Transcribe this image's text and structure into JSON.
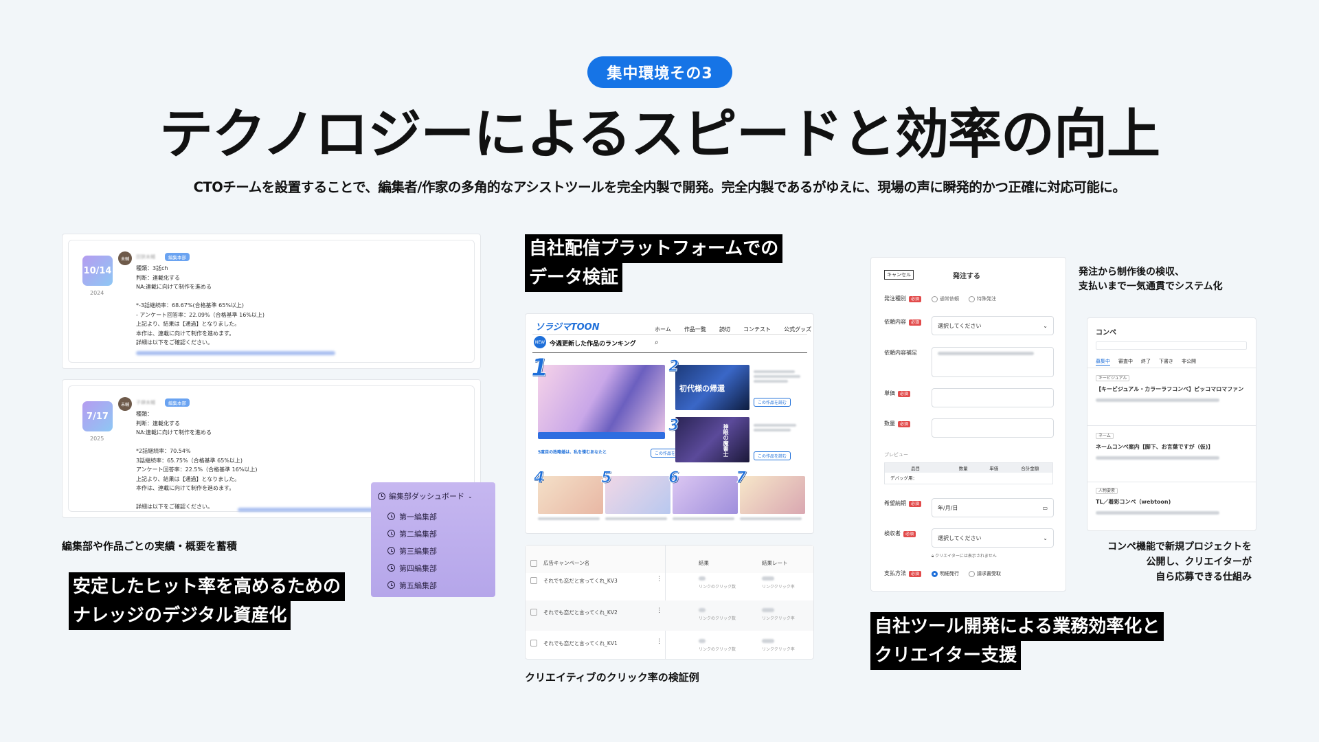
{
  "header": {
    "badge": "集中環境その3",
    "title": "テクノロジーによるスピードと効率の向上",
    "subtitle": "CTOチームを設置することで、編集者/作家の多角的なアシストツールを完全内製で開発。完全内製であるがゆえに、現場の声に瞬発的かつ正確に対応可能に。"
  },
  "knowledge": {
    "entries": [
      {
        "date": "10/14",
        "year": "2024",
        "avatar": "未輔",
        "name": "田狭未輔",
        "chip": "編集本部",
        "lines": [
          "種類：3話ch",
          "判断：連載化する",
          "NA:連載に向けて制作を進める",
          "",
          "*-3話継続率：68.67%(合格基準 65%以上)",
          "- アンケート回答率：22.09%（合格基準 16%以上)",
          "上記より、結果は【通過】となりました。",
          "本作は、連載に向けて制作を進めます。",
          "詳細は以下をご確認ください。"
        ]
      },
      {
        "date": "7/17",
        "year": "2025",
        "avatar": "未輔",
        "name": "子肆未輔",
        "chip": "編集本部",
        "lines": [
          "種類：",
          "判断：連載化する",
          "NA:連載に向けて制作を進める",
          "",
          "*2話継続率：70.54%",
          "3話継続率：65.75%（合格基準 65%以上)",
          "アンケート回答率：22.5%（合格基準 16%以上)",
          "上記より、結果は【通過】となりました。",
          "本作は、連載に向けて制作を進めます。",
          "",
          "詳細は以下をご確認ください。"
        ]
      }
    ],
    "dashboard": {
      "title": "編集部ダッシュボード",
      "items": [
        "第一編集部",
        "第二編集部",
        "第三編集部",
        "第四編集部",
        "第五編集部"
      ]
    },
    "caption": "編集部や作品ごとの実績・概要を蓄積",
    "highlight": [
      "安定したヒット率を高めるための",
      "ナレッジのデジタル資産化"
    ]
  },
  "platform": {
    "highlight": [
      "自社配信プラットフォームでの",
      "データ検証"
    ],
    "logo": "ソラジマTOON",
    "nav": [
      "ホーム",
      "作品一覧",
      "読切",
      "コンテスト",
      "公式グッズ"
    ],
    "ranking_title": "今週更新した作品のランキング",
    "rank1_title": "5度目の政略婚は、私を憎むあなたと",
    "rank2_title": "初代様の帰還",
    "rank3_title": "神眼の魔書士",
    "read_btn": "この作品を読む",
    "table": {
      "headers": [
        "広告キャンペーン名",
        "結果",
        "結果レート"
      ],
      "rows": [
        "それでも恋だと言ってくれ_KV3",
        "それでも恋だと言ってくれ_KV2",
        "それでも恋だと言ってくれ_KV1"
      ],
      "result_sub": "リンクのクリック数",
      "rate_sub": "リンククリック率"
    },
    "caption": "クリエイティブのクリック率の検証例"
  },
  "tools": {
    "order": {
      "cancel": "キャンセル",
      "title": "発注する",
      "fields": [
        "発注種別",
        "依頼内容",
        "依頼内容補足",
        "単価",
        "数量"
      ],
      "required": "必須",
      "radio_type": [
        "通常依頼",
        "特殊発注"
      ],
      "select_placeholder": "選択してください",
      "preview": "プレビュー",
      "preview_headers": [
        "品目",
        "数量",
        "単価",
        "合計金額"
      ],
      "preview_row": "デバッグ用：",
      "deadline_label": "希望納期",
      "deadline_value": "年/月/日",
      "receiver_label": "検収者",
      "receiver_note": "クリエイターには表示されません",
      "payment_label": "支払方法",
      "payment_options": [
        "明細発行",
        "請求書受取"
      ]
    },
    "order_caption": [
      "発注から制作後の検収、",
      "支払いまで一気通貫でシステム化"
    ],
    "konpe": {
      "title": "コンペ",
      "tabs": [
        "募集中",
        "審査中",
        "終了",
        "下書き",
        "非公開"
      ],
      "items": [
        {
          "tag": "キービジュアル",
          "title": "【キービジュアル・カラーラフコンペ】ピッコマロマファン"
        },
        {
          "tag": "ネーム",
          "title": "ネームコンペ案内【脚下、お言葉ですが（仮)】"
        },
        {
          "tag": "人物要素",
          "title": "TL／着彩コンペ（webtoon)"
        }
      ]
    },
    "konpe_caption": [
      "コンペ機能で新規プロジェクトを",
      "公開し、クリエイターが",
      "自ら応募できる仕組み"
    ],
    "highlight": [
      "自社ツール開発による業務効率化と",
      "クリエイター支援"
    ]
  }
}
